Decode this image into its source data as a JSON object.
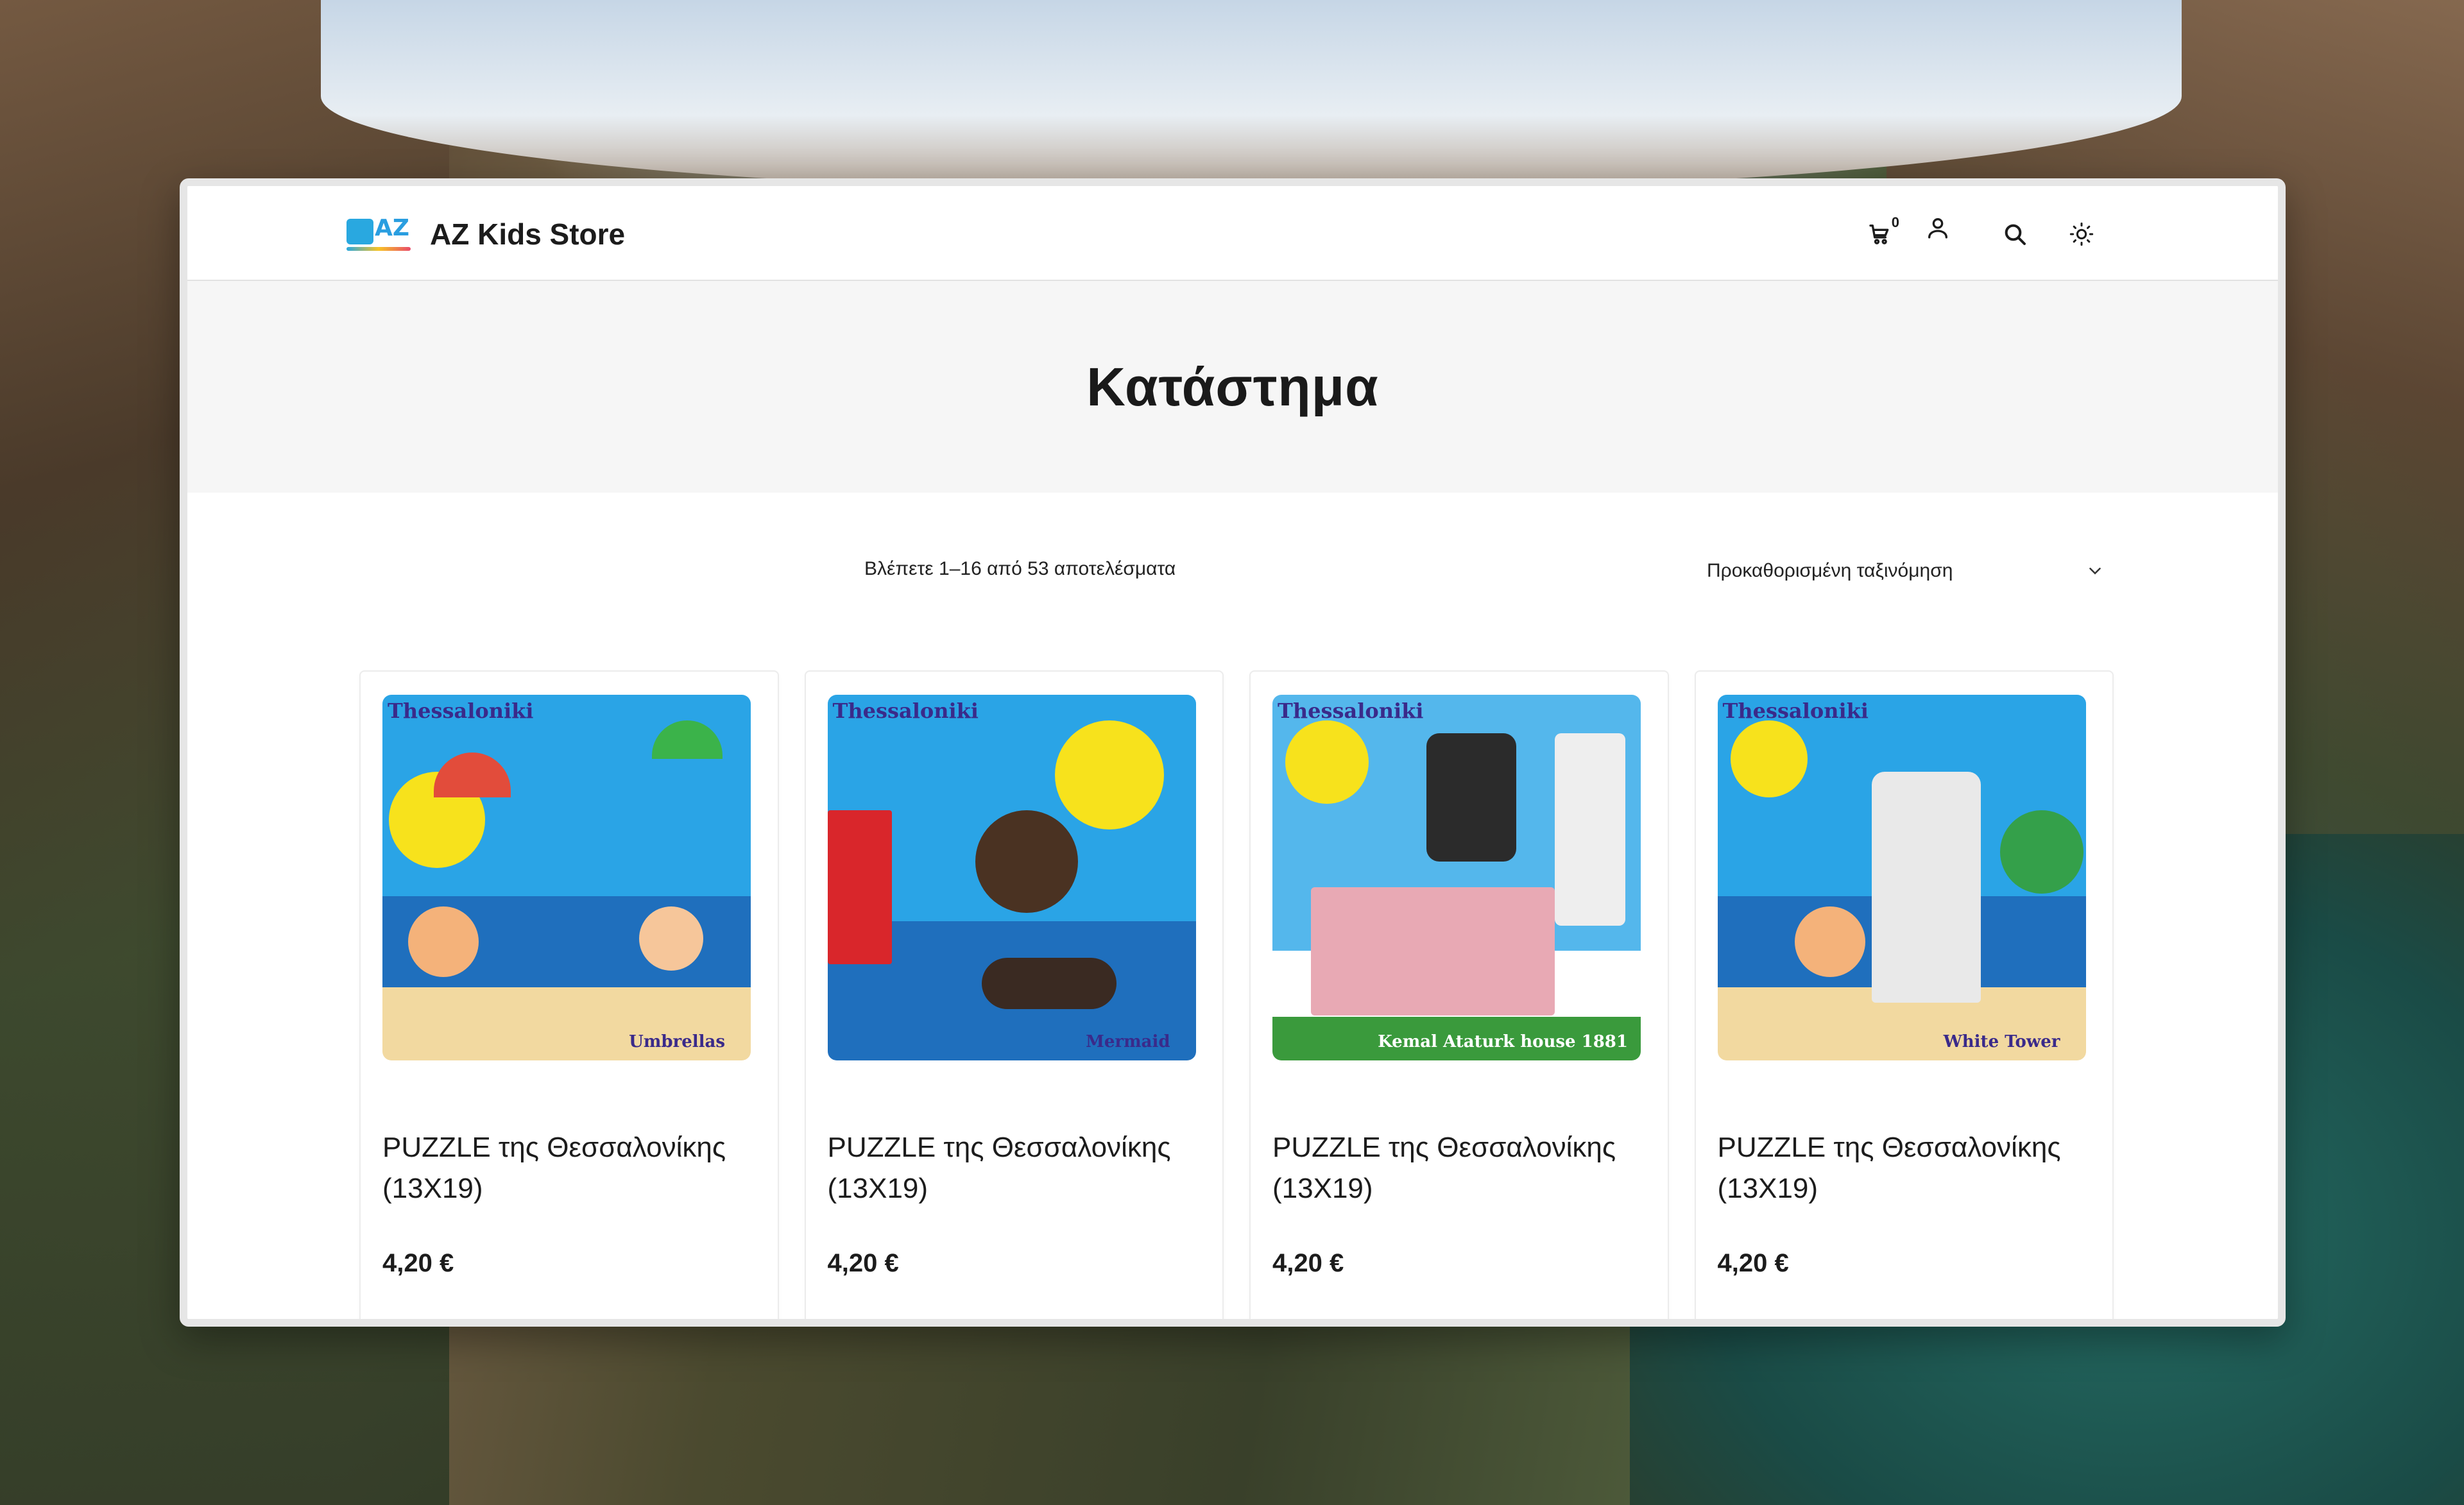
{
  "header": {
    "brand": "AZ Kids Store",
    "logo_text": "AZ",
    "cart_count": "0"
  },
  "page": {
    "title": "Κατάστημα"
  },
  "toolbar": {
    "result_count": "Βλέπετε 1–16 από 53 αποτελέσματα",
    "sort_label": "Προκαθορισμένη ταξινόμηση"
  },
  "products": [
    {
      "image_label": "Thessaloniki",
      "image_caption": "Umbrellas",
      "title": "PUZZLE της Θεσσαλονίκης (13X19)",
      "price": "4,20 €"
    },
    {
      "image_label": "Thessaloniki",
      "image_caption": "Mermaid",
      "title": "PUZZLE της Θεσσαλονίκης (13X19)",
      "price": "4,20 €"
    },
    {
      "image_label": "Thessaloniki",
      "image_caption": "Kemal Ataturk house 1881",
      "title": "PUZZLE της Θεσσαλονίκης (13X19)",
      "price": "4,20 €"
    },
    {
      "image_label": "Thessaloniki",
      "image_caption": "White Tower",
      "title": "PUZZLE της Θεσσαλονίκης (13X19)",
      "price": "4,20 €"
    }
  ],
  "icons": {
    "cart": "cart-icon",
    "user": "user-icon",
    "search": "search-icon",
    "theme": "sun-icon",
    "sort": "chevron-down-icon"
  },
  "colors": {
    "accent_sky": "#2aa4e6",
    "accent_sun": "#f7e21c",
    "text": "#1c1c1c",
    "band": "#f6f6f6"
  }
}
